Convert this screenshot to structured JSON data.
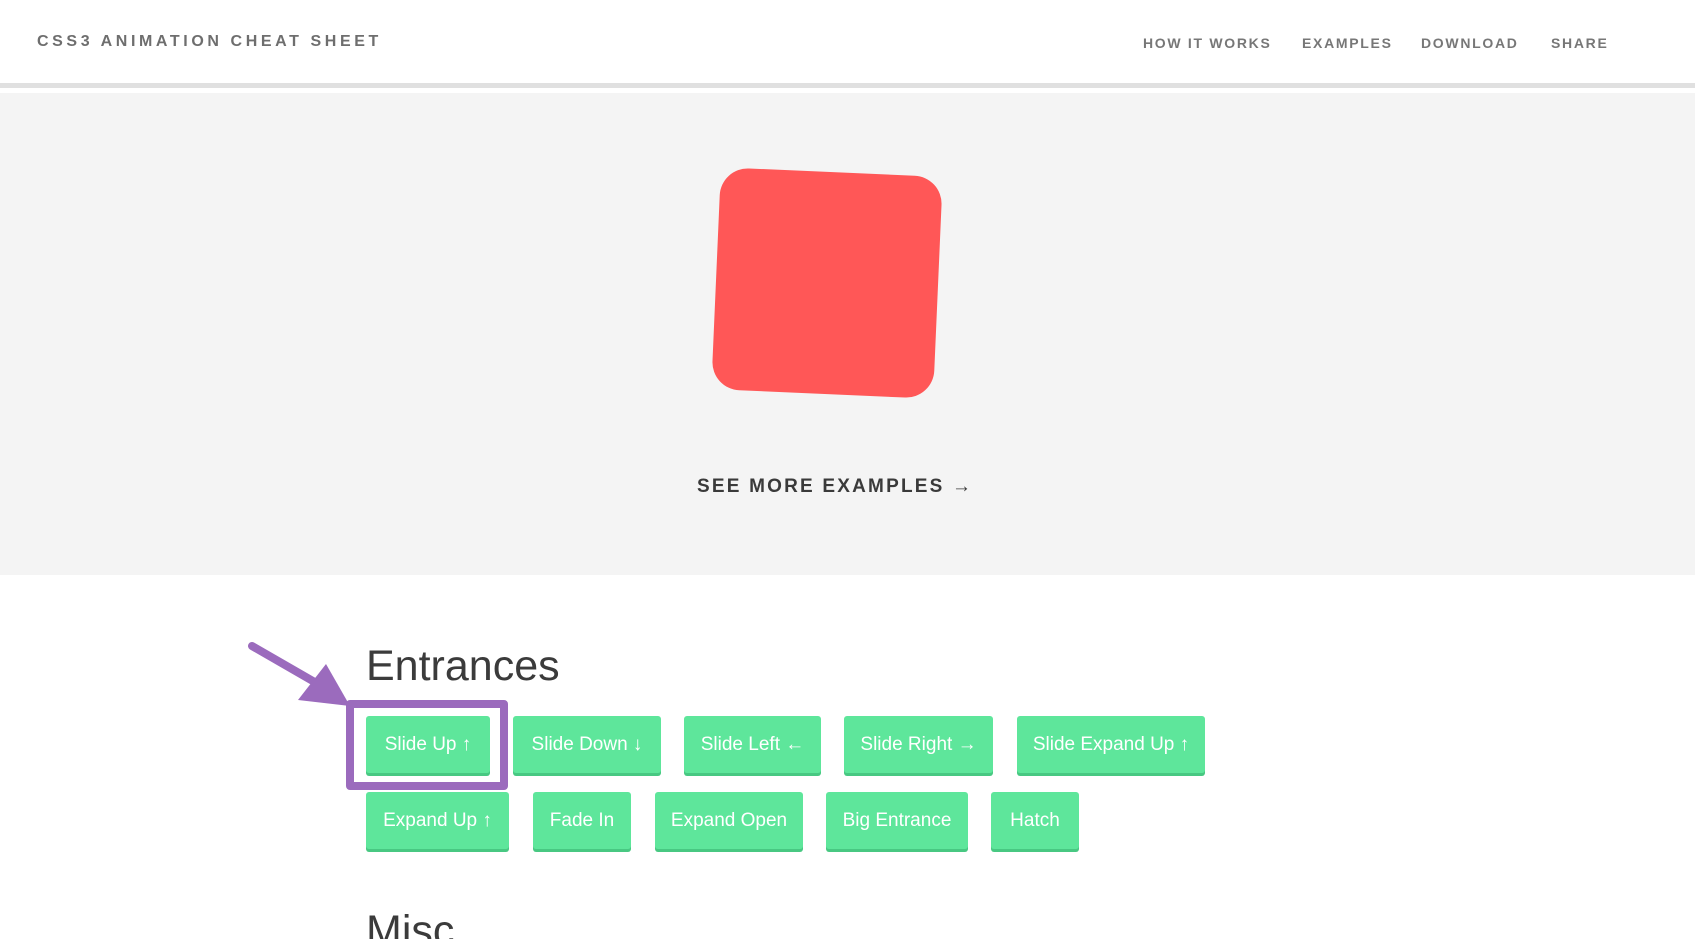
{
  "header": {
    "brand": "CSS3 ANIMATION CHEAT SHEET",
    "nav": [
      "HOW IT WORKS",
      "EXAMPLES",
      "DOWNLOAD",
      "SHARE"
    ]
  },
  "hero": {
    "see_more": "SEE MORE EXAMPLES →"
  },
  "entrances": {
    "title": "Entrances",
    "buttons": [
      "Slide Up ↑",
      "Slide Down ↓",
      "Slide Left ←",
      "Slide Right →",
      "Slide Expand Up ↑",
      "Expand Up ↑",
      "Fade In",
      "Expand Open",
      "Big Entrance",
      "Hatch"
    ]
  },
  "misc": {
    "title": "Misc"
  },
  "colors": {
    "accent_button": "#5ee69b",
    "demo_box": "#ff5757",
    "highlight": "#9b6bbd"
  }
}
